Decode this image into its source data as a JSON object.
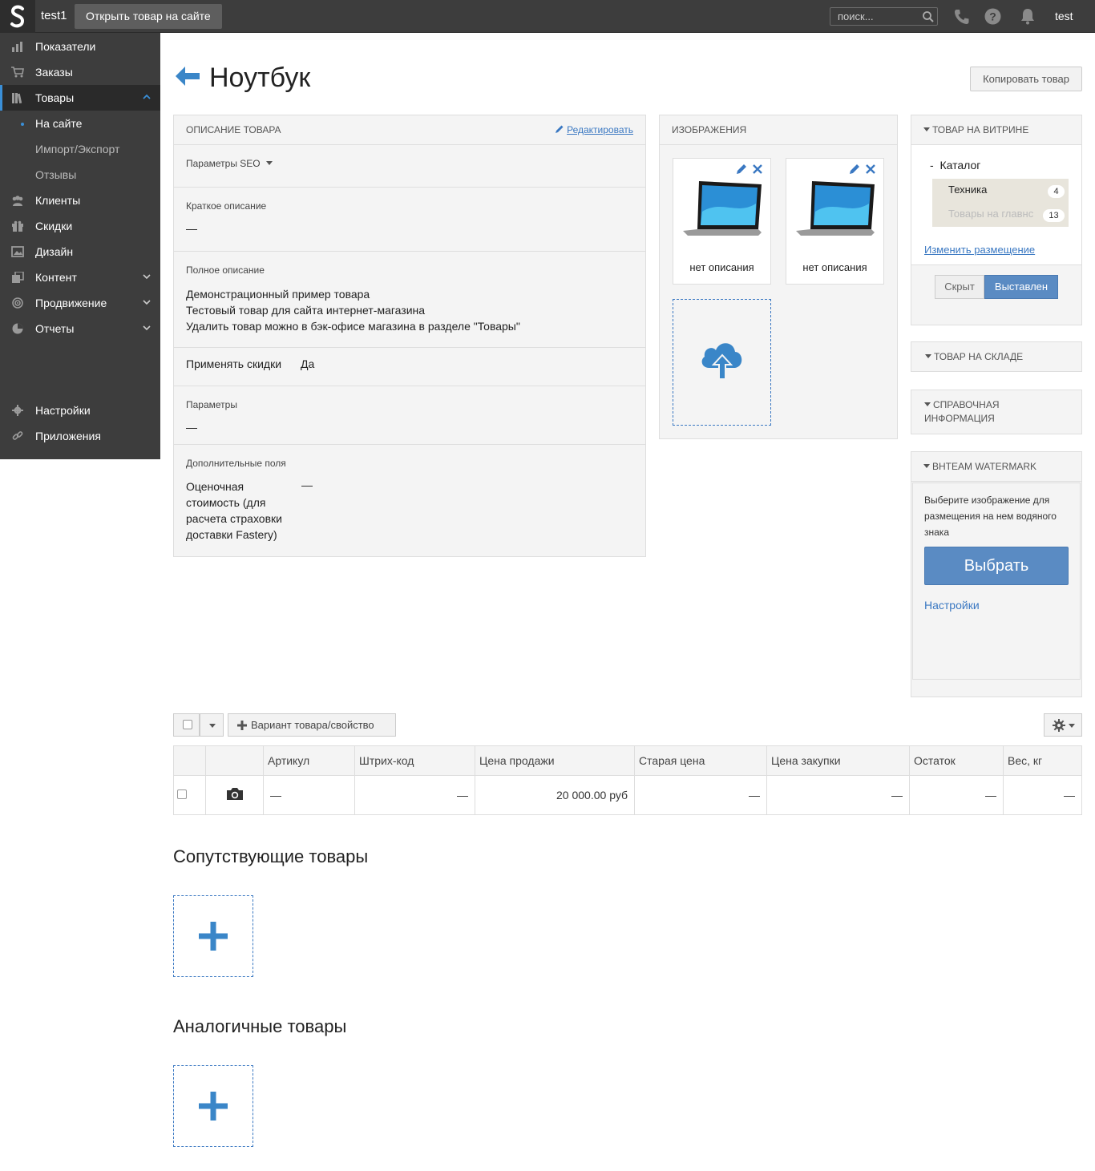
{
  "topbar": {
    "site_name": "test1",
    "open_site_label": "Открыть товар на сайте",
    "search_placeholder": "поиск...",
    "user_name": "test"
  },
  "sidebar": {
    "items": [
      {
        "label": "Показатели",
        "icon": "chart-icon"
      },
      {
        "label": "Заказы",
        "icon": "cart-icon"
      },
      {
        "label": "Товары",
        "icon": "books-icon"
      },
      {
        "label": "Клиенты",
        "icon": "users-icon"
      },
      {
        "label": "Скидки",
        "icon": "gift-icon"
      },
      {
        "label": "Дизайн",
        "icon": "image-icon"
      },
      {
        "label": "Контент",
        "icon": "pages-icon"
      },
      {
        "label": "Продвижение",
        "icon": "target-icon"
      },
      {
        "label": "Отчеты",
        "icon": "pie-icon"
      },
      {
        "label": "Настройки",
        "icon": "gear-icon"
      },
      {
        "label": "Приложения",
        "icon": "link-icon"
      }
    ],
    "sub_items": [
      {
        "label": "На сайте"
      },
      {
        "label": "Импорт/Экспорт"
      },
      {
        "label": "Отзывы"
      }
    ]
  },
  "page": {
    "title": "Ноутбук",
    "copy_label": "Копировать товар"
  },
  "description_panel": {
    "heading": "Описание товара",
    "edit_label": "Редактировать",
    "seo_label": "Параметры SEO",
    "short_label": "Краткое описание",
    "short_value": "—",
    "full_label": "Полное описание",
    "full_lines": [
      "Демонстрационный пример товара",
      "Тестовый товар для сайта интернет-магазина",
      "Удалить товар можно в бэк-офисе магазина в разделе \"Товары\""
    ],
    "discounts_label": "Применять скидки",
    "discounts_value": "Да",
    "params_label": "Параметры",
    "params_value": "—",
    "extra_label": "Дополнительные поля",
    "extra_field_label": "Оценочная стоимость (для расчета страховки доставки Fastery)",
    "extra_field_value": "—"
  },
  "images_panel": {
    "heading": "Изображения",
    "images": [
      {
        "caption": "нет описания"
      },
      {
        "caption": "нет описания"
      }
    ]
  },
  "storefront_panel": {
    "heading": "Товар на витрине",
    "catalog_label": "Каталог",
    "categories": [
      {
        "label": "Техника",
        "count": "4"
      },
      {
        "label": "Товары на главнс",
        "count": "13"
      }
    ],
    "change_label": "Изменить размещение",
    "hidden_label": "Скрыт",
    "shown_label": "Выставлен"
  },
  "stock_panel": {
    "heading": "Товар на складе"
  },
  "info_panel": {
    "heading_line1": "Справочная",
    "heading_line2": "информация"
  },
  "watermark_panel": {
    "heading": "BHTEAM WATERMARK",
    "hint": "Выберите изображение для размещения на нем водяного знака",
    "choose_label": "Выбрать",
    "settings_label": "Настройки"
  },
  "skus": {
    "add_variant_label": "Вариант товара/свойство",
    "columns": [
      "",
      "",
      "Артикул",
      "Штрих-код",
      "Цена продажи",
      "Старая цена",
      "Цена закупки",
      "Остаток",
      "Вес, кг"
    ],
    "row": {
      "sku": "—",
      "barcode": "—",
      "price": "20 000.00 руб",
      "old_price": "—",
      "purchase_price": "—",
      "stock": "—",
      "weight": "—"
    }
  },
  "related": {
    "title": "Сопутствующие товары"
  },
  "similar": {
    "title": "Аналогичные товары"
  },
  "colors": {
    "accent": "#3a78c2",
    "sidebar_bg": "#3d3d3d",
    "active_btn": "#5a8bc3"
  }
}
